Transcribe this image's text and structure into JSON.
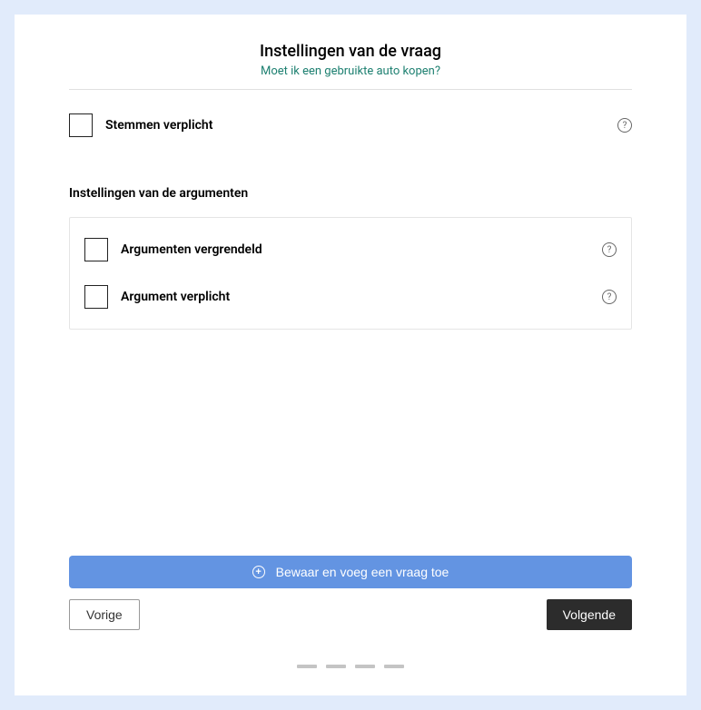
{
  "header": {
    "title": "Instellingen van de vraag",
    "subtitle": "Moet ik een gebruikte auto kopen?"
  },
  "settings": {
    "votes_required": {
      "label": "Stemmen verplicht",
      "checked": false
    }
  },
  "arguments_section": {
    "title": "Instellingen van de argumenten",
    "locked": {
      "label": "Argumenten vergrendeld",
      "checked": false
    },
    "required": {
      "label": "Argument verplicht",
      "checked": false
    }
  },
  "footer": {
    "save_add": "Bewaar en voeg een vraag toe",
    "prev": "Vorige",
    "next": "Volgende"
  },
  "help_glyph": "?",
  "plus_glyph": "+"
}
